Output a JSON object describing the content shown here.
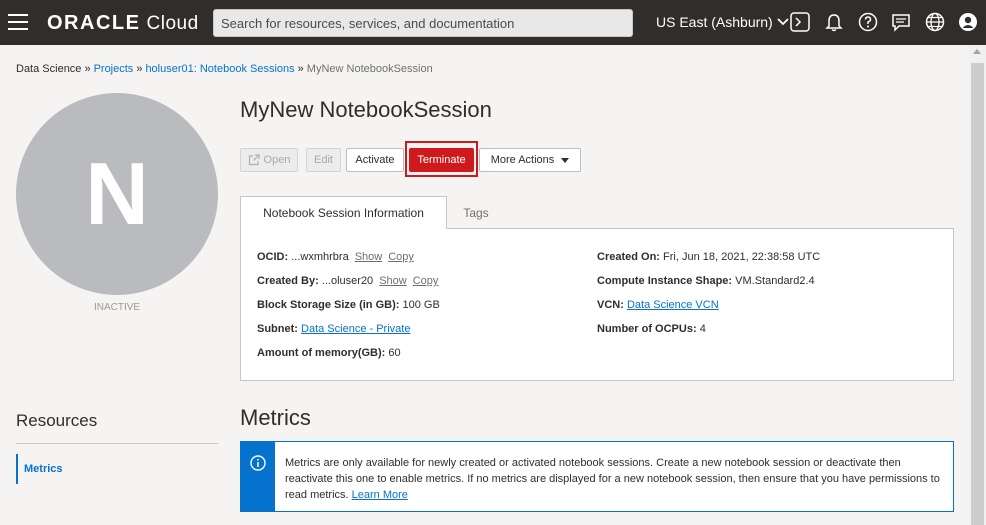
{
  "header": {
    "brand": "ORACLE",
    "brand_suffix": "Cloud",
    "search_placeholder": "Search for resources, services, and documentation",
    "region": "US East (Ashburn)"
  },
  "breadcrumb": {
    "items": [
      "Data Science",
      "Projects",
      "holuser01: Notebook Sessions"
    ],
    "separator": "»",
    "current": "MyNew NotebookSession"
  },
  "avatar": {
    "letter": "N",
    "status": "INACTIVE"
  },
  "page": {
    "title": "MyNew NotebookSession"
  },
  "actions": {
    "open": "Open",
    "edit": "Edit",
    "activate": "Activate",
    "terminate": "Terminate",
    "more_actions": "More Actions"
  },
  "tabs": {
    "info": "Notebook Session Information",
    "tags": "Tags"
  },
  "info": {
    "ocid_label": "OCID:",
    "ocid_value": "...wxmhrbra",
    "created_by_label": "Created By:",
    "created_by_value": "...oluser20",
    "show": "Show",
    "copy": "Copy",
    "block_storage_label": "Block Storage Size (in GB):",
    "block_storage_value": "100 GB",
    "subnet_label": "Subnet:",
    "subnet_value": "Data Science - Private",
    "memory_label": "Amount of memory(GB):",
    "memory_value": "60",
    "created_on_label": "Created On:",
    "created_on_value": "Fri, Jun 18, 2021, 22:38:58 UTC",
    "shape_label": "Compute Instance Shape:",
    "shape_value": "VM.Standard2.4",
    "vcn_label": "VCN:",
    "vcn_value": "Data Science VCN",
    "ocpus_label": "Number of OCPUs:",
    "ocpus_value": "4"
  },
  "resources": {
    "title": "Resources",
    "items": [
      "Metrics"
    ]
  },
  "metrics": {
    "title": "Metrics",
    "notice": "Metrics are only available for newly created or activated notebook sessions. Create a new notebook session or deactivate then reactivate this one to enable metrics. If no metrics are displayed for a new notebook session, then ensure that you have permissions to read metrics.",
    "learn_more": "Learn More"
  },
  "colors": {
    "topbar": "#312d2a",
    "link": "#0572ce",
    "danger": "#d0191d",
    "avatar": "#b9bbbf"
  }
}
